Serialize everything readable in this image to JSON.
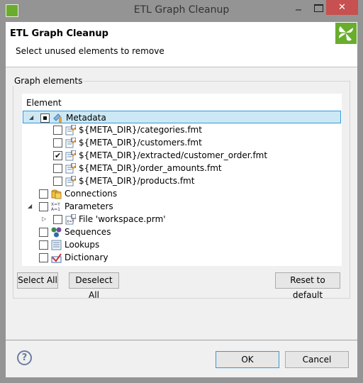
{
  "window": {
    "title": "ETL Graph Cleanup",
    "close_glyph": "✕"
  },
  "header": {
    "title": "ETL Graph Cleanup",
    "subtitle": "Select unused elements to remove"
  },
  "group": {
    "label": "Graph elements",
    "column_header": "Element"
  },
  "tree": [
    {
      "label": "Metadata",
      "level": 0,
      "expanded": true,
      "check": "partial",
      "icon": "metadata-icon",
      "selected": true
    },
    {
      "label": "${META_DIR}/categories.fmt",
      "level": 1,
      "check": "unchecked",
      "icon": "metadata-file-icon"
    },
    {
      "label": "${META_DIR}/customers.fmt",
      "level": 1,
      "check": "unchecked",
      "icon": "metadata-file-icon"
    },
    {
      "label": "${META_DIR}/extracted/customer_order.fmt",
      "level": 1,
      "check": "checked",
      "icon": "metadata-file-icon"
    },
    {
      "label": "${META_DIR}/order_amounts.fmt",
      "level": 1,
      "check": "unchecked",
      "icon": "metadata-file-icon"
    },
    {
      "label": "${META_DIR}/products.fmt",
      "level": 1,
      "check": "unchecked",
      "icon": "metadata-file-icon"
    },
    {
      "label": "Connections",
      "level": 0,
      "check": "unchecked",
      "icon": "connections-icon"
    },
    {
      "label": "Parameters",
      "level": 0,
      "expanded": true,
      "check": "unchecked",
      "icon": "parameters-icon"
    },
    {
      "label": "File 'workspace.prm'",
      "level": 1,
      "expanded": false,
      "check": "unchecked",
      "icon": "parameter-file-icon"
    },
    {
      "label": "Sequences",
      "level": 0,
      "check": "unchecked",
      "icon": "sequences-icon"
    },
    {
      "label": "Lookups",
      "level": 0,
      "check": "unchecked",
      "icon": "lookups-icon"
    },
    {
      "label": "Dictionary",
      "level": 0,
      "check": "unchecked",
      "icon": "dictionary-icon"
    }
  ],
  "buttons": {
    "select_all": "Select All",
    "deselect_all": "Deselect All",
    "reset": "Reset to default",
    "ok": "OK",
    "cancel": "Cancel",
    "help": "?"
  },
  "colors": {
    "brand_green": "#6aad2d",
    "selection_bg": "#cce8f4",
    "selection_border": "#3399dd",
    "close_red": "#c75050"
  }
}
